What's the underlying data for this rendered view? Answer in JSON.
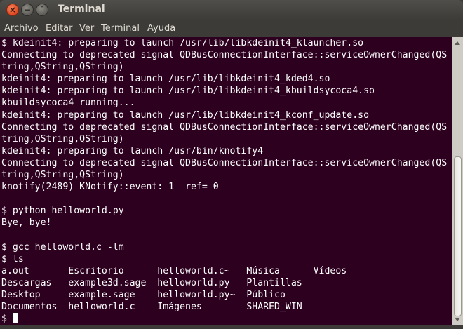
{
  "window": {
    "title": "Terminal"
  },
  "menu": [
    "Archivo",
    "Editar",
    "Ver",
    "Terminal",
    "Ayuda"
  ],
  "terminal": {
    "lines": [
      "$ kdeinit4: preparing to launch /usr/lib/libkdeinit4_klauncher.so",
      "Connecting to deprecated signal QDBusConnectionInterface::serviceOwnerChanged(QS",
      "tring,QString,QString)",
      "kdeinit4: preparing to launch /usr/lib/libkdeinit4_kded4.so",
      "kdeinit4: preparing to launch /usr/lib/libkdeinit4_kbuildsycoca4.so",
      "kbuildsycoca4 running...",
      "kdeinit4: preparing to launch /usr/lib/libkdeinit4_kconf_update.so",
      "Connecting to deprecated signal QDBusConnectionInterface::serviceOwnerChanged(QS",
      "tring,QString,QString)",
      "kdeinit4: preparing to launch /usr/bin/knotify4",
      "Connecting to deprecated signal QDBusConnectionInterface::serviceOwnerChanged(QS",
      "tring,QString,QString)",
      "knotify(2489) KNotify::event: 1  ref= 0",
      "",
      "$ python helloworld.py",
      "Bye, bye!",
      "",
      "$ gcc helloworld.c -lm",
      "$ ls",
      "a.out       Escritorio      helloworld.c~   Música      Vídeos",
      "Descargas   example3d.sage  helloworld.py   Plantillas",
      "Desktop     example.sage    helloworld.py~  Público",
      "Documentos  helloworld.c    Imágenes        SHARED_WIN"
    ],
    "prompt": "$ "
  }
}
